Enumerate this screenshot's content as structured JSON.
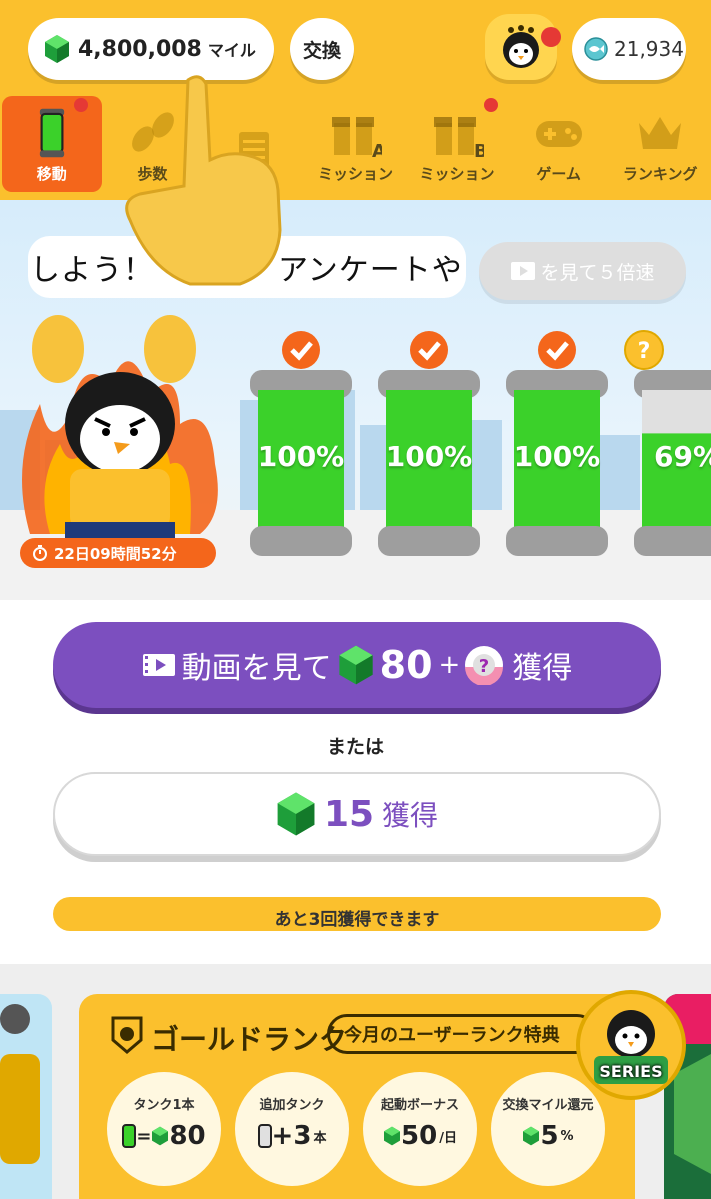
{
  "header": {
    "miles_value": "4,800,008",
    "miles_unit": "マイル",
    "exchange_label": "交換",
    "coins_value": "21,934"
  },
  "nav": {
    "items": [
      {
        "label": "移動",
        "icon": "tank-icon",
        "active": true,
        "notify": true
      },
      {
        "label": "歩数",
        "icon": "footsteps-icon"
      },
      {
        "label": "",
        "icon": "clipboard-icon"
      },
      {
        "label": "ミッション",
        "icon": "gift-a-icon"
      },
      {
        "label": "ミッション",
        "icon": "gift-b-icon",
        "notify": true
      },
      {
        "label": "ゲーム",
        "icon": "gamepad-icon"
      },
      {
        "label": "ランキング",
        "icon": "crown-icon"
      }
    ]
  },
  "scene": {
    "speech_text": "しよう！　　　　アンケートや",
    "speed_button_label": "を見て５倍速",
    "timer_text": "22日09時間52分",
    "tanks": [
      {
        "label": "100%",
        "level": 100,
        "status": "checked"
      },
      {
        "label": "100%",
        "level": 100,
        "status": "checked"
      },
      {
        "label": "100%",
        "level": 100,
        "status": "checked"
      },
      {
        "label": "69%",
        "level": 69,
        "status": "unknown"
      }
    ]
  },
  "actions": {
    "video_prefix": "動画を見て",
    "video_gems": "80",
    "video_plus": "+",
    "video_suffix": "獲得",
    "or_text": "または",
    "gain_value": "15",
    "gain_label": "獲得",
    "remaining_text": "あと3回獲得できます"
  },
  "gold_rank": {
    "title": "ゴールドランク",
    "tag": "今月のユーザーランク特典",
    "perks": [
      {
        "title": "タンク1本",
        "value": "80",
        "prefix": "="
      },
      {
        "title": "追加タンク",
        "value": "+3",
        "unit": "本"
      },
      {
        "title": "起動ボーナス",
        "value": "50",
        "unit": "/日"
      },
      {
        "title": "交換マイル還元",
        "value": "5",
        "unit": "%"
      }
    ],
    "series_label": "SERIES"
  },
  "colors": {
    "header_yellow": "#fbc02d",
    "active_orange": "#f4661b",
    "purple": "#7c4fbf",
    "tank_green": "#3bd12a"
  }
}
